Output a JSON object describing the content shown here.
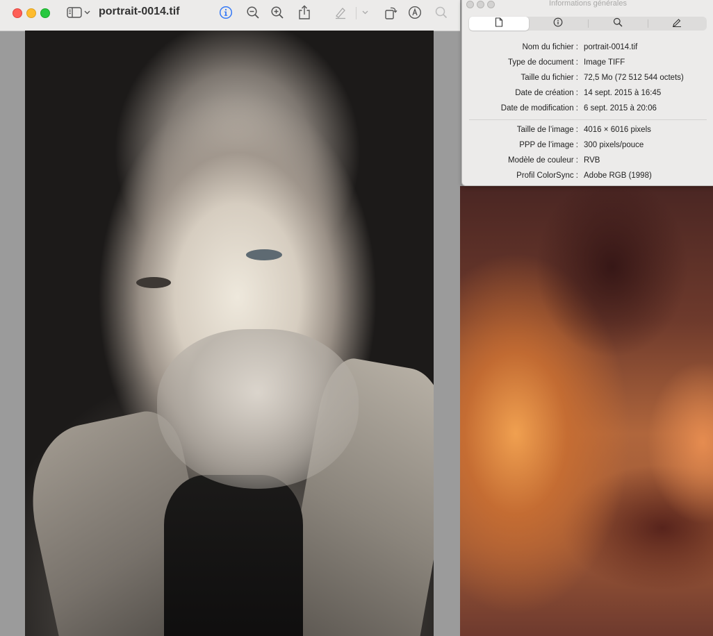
{
  "window": {
    "title": "portrait-0014.tif"
  },
  "toolbar": {
    "icons": [
      "sidebar-icon",
      "chevron-down-icon",
      "info-icon",
      "zoom-out-icon",
      "zoom-in-icon",
      "share-icon",
      "highlighter-icon",
      "chevron-down-icon",
      "rotate-icon",
      "markup-icon",
      "search-icon"
    ],
    "accent_color": "#3478f6"
  },
  "info_panel": {
    "title": "Informations générales",
    "tabs": [
      {
        "icon": "document-icon",
        "active": true
      },
      {
        "icon": "info-icon",
        "active": false
      },
      {
        "icon": "search-icon",
        "active": false
      },
      {
        "icon": "pencil-icon",
        "active": false
      }
    ],
    "file_rows": [
      {
        "label": "Nom du fichier :",
        "value": "portrait-0014.tif"
      },
      {
        "label": "Type de document :",
        "value": "Image TIFF"
      },
      {
        "label": "Taille du fichier :",
        "value": "72,5 Mo (72 512 544 octets)"
      },
      {
        "label": "Date de création :",
        "value": "14 sept. 2015 à 16:45"
      },
      {
        "label": "Date de modification :",
        "value": "6 sept. 2015 à 20:06"
      }
    ],
    "image_rows": [
      {
        "label": "Taille de l’image :",
        "value": "4016 × 6016 pixels"
      },
      {
        "label": "PPP de l’image :",
        "value": "300 pixels/pouce"
      },
      {
        "label": "Modèle de couleur :",
        "value": "RVB"
      },
      {
        "label": "Profil ColorSync :",
        "value": "Adobe RGB (1998)"
      }
    ]
  }
}
